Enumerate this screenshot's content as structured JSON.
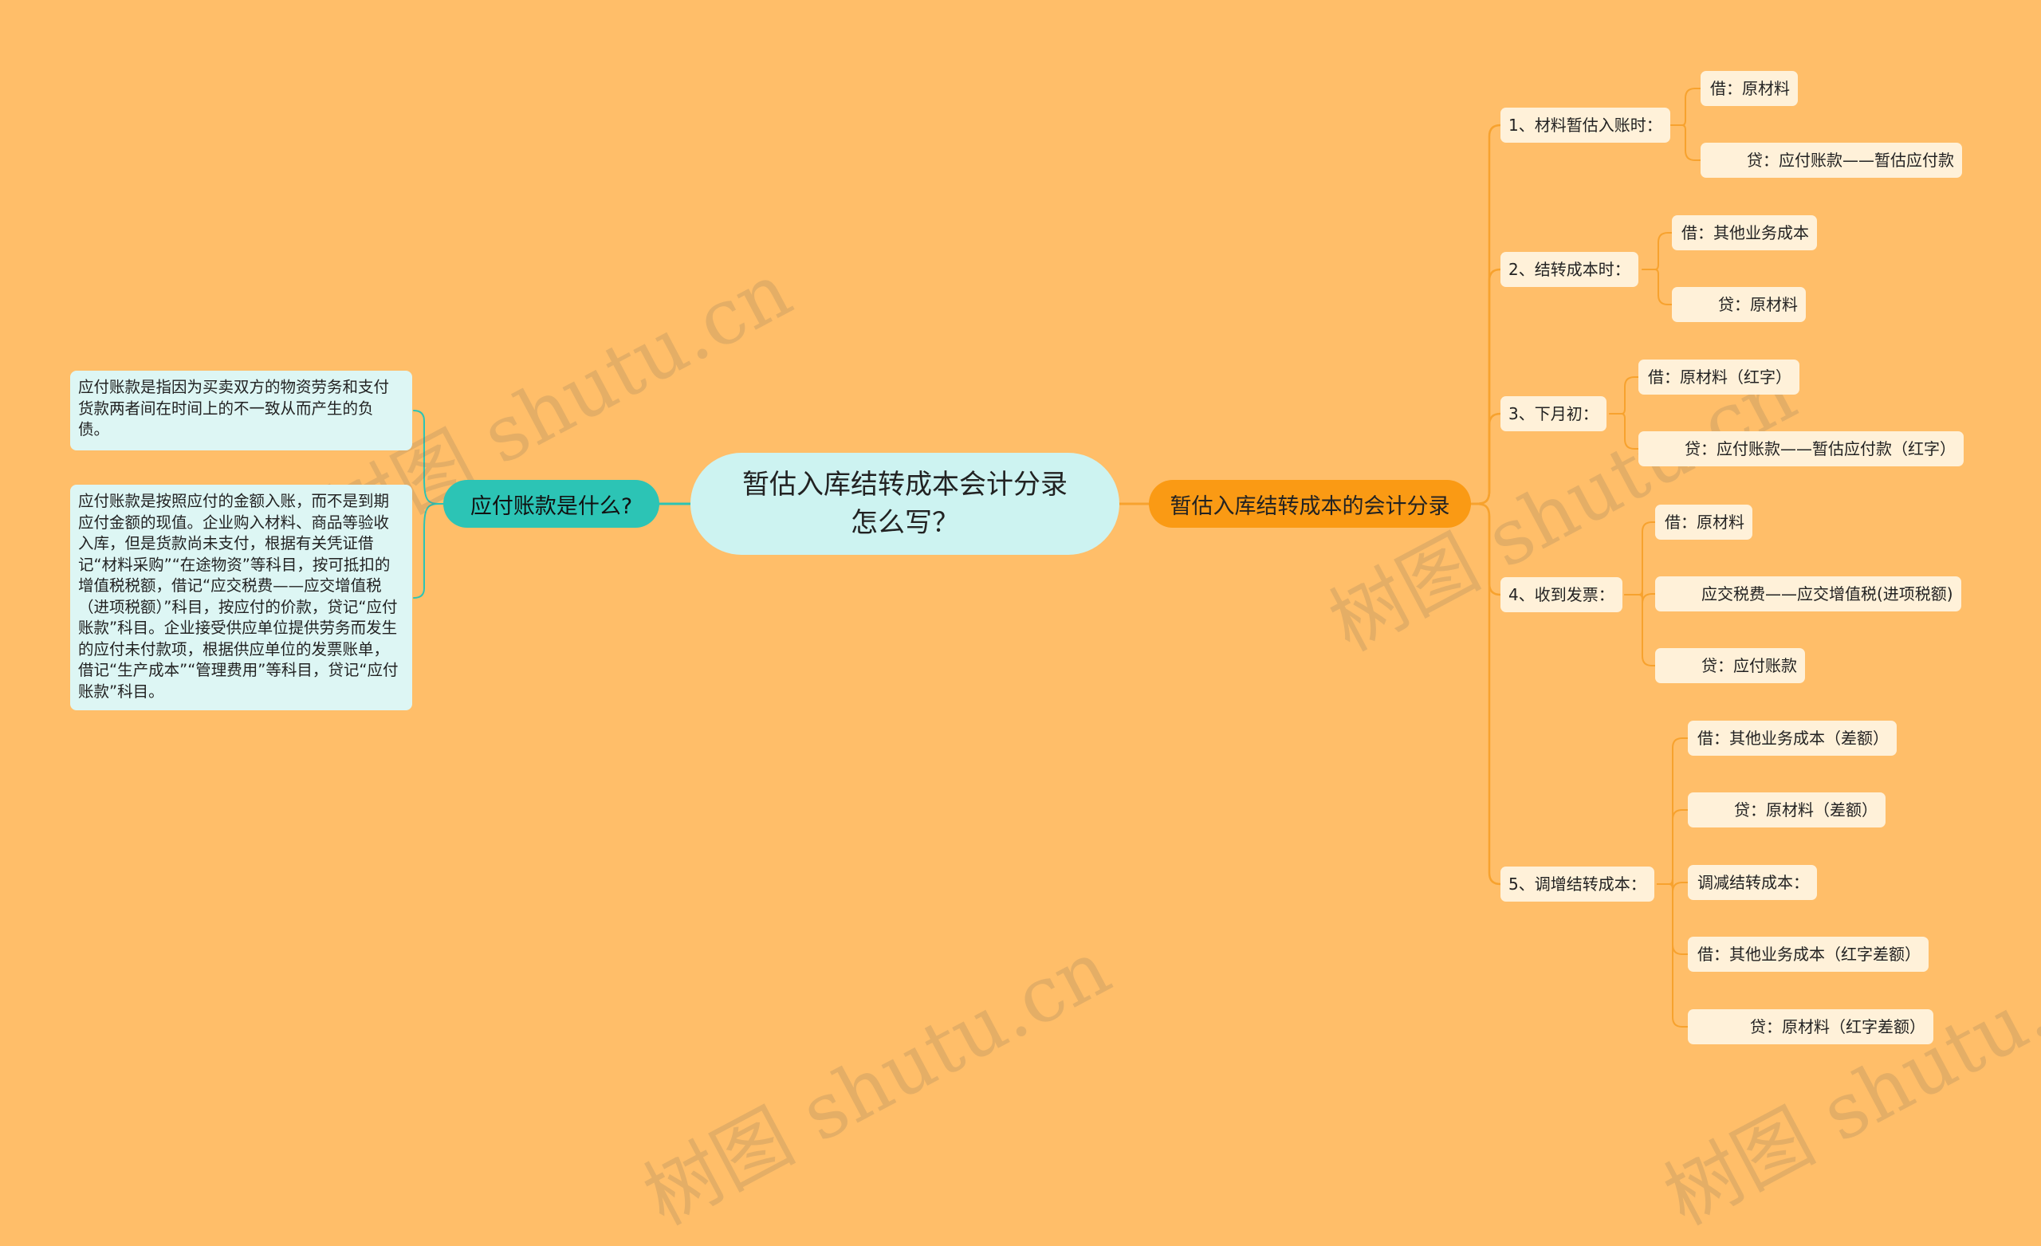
{
  "root": {
    "title": "暂估入库结转成本会计分录怎么写？"
  },
  "right_branch": {
    "label": "暂估入库结转成本的会计分录",
    "groups": [
      {
        "label": "1、材料暂估入账时：",
        "items": [
          "借：原材料",
          "贷：应付账款——暂估应付款"
        ]
      },
      {
        "label": "2、结转成本时：",
        "items": [
          "借：其他业务成本",
          "贷：原材料"
        ]
      },
      {
        "label": "3、下月初：",
        "items": [
          "借：原材料（红字）",
          "贷：应付账款——暂估应付款（红字）"
        ]
      },
      {
        "label": "4、收到发票：",
        "items": [
          "借：原材料",
          "应交税费——应交增值税(进项税额)",
          "贷：应付账款"
        ]
      },
      {
        "label": "5、调增结转成本：",
        "items": [
          "借：其他业务成本（差额）",
          "贷：原材料（差额）",
          "调减结转成本：",
          "借：其他业务成本（红字差额）",
          "贷：原材料（红字差额）"
        ]
      }
    ]
  },
  "left_branch": {
    "label": "应付账款是什么?",
    "notes": [
      "应付账款是指因为买卖双方的物资劳务和支付货款两者间在时间上的不一致从而产生的负债。",
      "应付账款是按照应付的金额入账，而不是到期应付金额的现值。企业购入材料、商品等验收入库，但是货款尚未支付，根据有关凭证借记“材料采购”“在途物资”等科目，按可抵扣的增值税税额，借记“应交税费——应交增值税（进项税额）”科目，按应付的价款，贷记“应付账款”科目。企业接受供应单位提供劳务而发生的应付未付款项，根据供应单位的发票账单，借记“生产成本”“管理费用”等科目，贷记“应付账款”科目。"
    ]
  },
  "watermark": {
    "text": "树图 shutu.cn"
  },
  "colors": {
    "background": "#FFBE69",
    "root_fill": "#CDF3F1",
    "right_main_fill": "#FA9A14",
    "left_main_fill": "#2CC4B5",
    "right_line": "#F7A22E",
    "left_line": "#2CC4B5",
    "leaf_fill": "#FFF1D9",
    "note_fill": "#DDF6F4"
  }
}
